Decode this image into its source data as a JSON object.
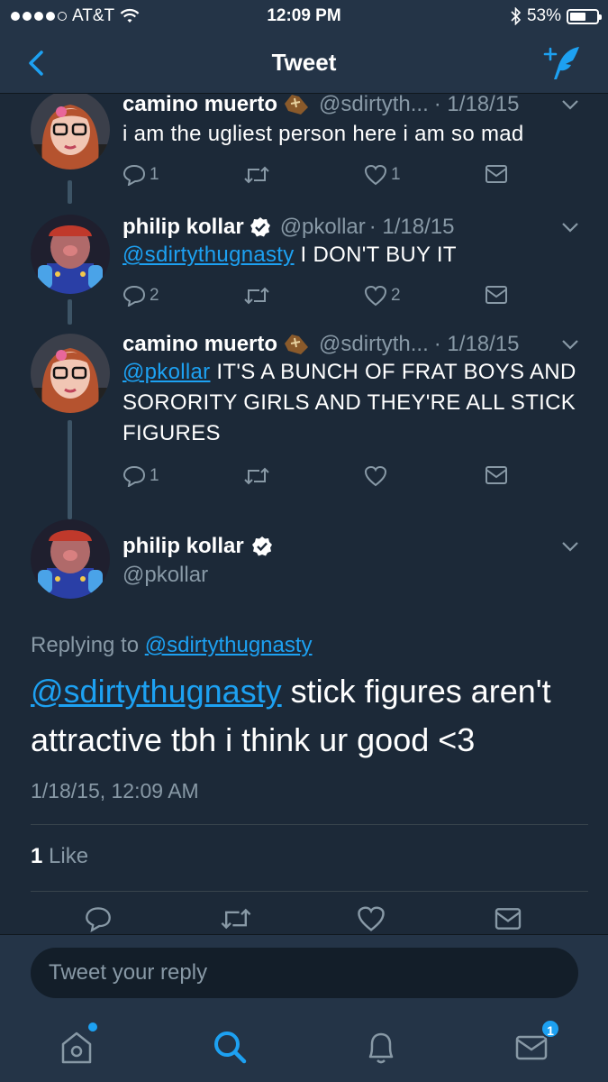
{
  "status_bar": {
    "carrier": "AT&T",
    "time": "12:09 PM",
    "battery": "53%"
  },
  "nav": {
    "title": "Tweet"
  },
  "thread": [
    {
      "name": "camino muerto",
      "handle": "@sdirtyth...",
      "date": "· 1/18/15",
      "text": "i am the ugliest person here i am so mad",
      "mention": "",
      "replies": "1",
      "likes": "1",
      "emoji": "coffin-icon"
    },
    {
      "name": "philip kollar",
      "handle": "@pkollar",
      "date": "· 1/18/15",
      "mention": "@sdirtythugnasty",
      "text": " I DON'T BUY IT",
      "replies": "2",
      "likes": "2",
      "verified": true
    },
    {
      "name": "camino muerto",
      "handle": "@sdirtyth...",
      "date": "· 1/18/15",
      "mention": "@pkollar",
      "text": " IT'S A BUNCH OF FRAT BOYS AND SORORITY GIRLS AND THEY'RE ALL STICK FIGURES",
      "replies": "1",
      "likes": "",
      "emoji": "coffin-icon"
    }
  ],
  "focused": {
    "name": "philip kollar",
    "handle": "@pkollar",
    "replying_label": "Replying to",
    "replying_to": "@sdirtythugnasty",
    "mention": "@sdirtythugnasty",
    "text": " stick figures aren't attractive tbh i think ur good <3",
    "timestamp": "1/18/15, 12:09 AM",
    "like_count": "1",
    "like_label": " Like"
  },
  "reply": {
    "placeholder": "Tweet your reply"
  },
  "tabs": {
    "messages_badge": "1"
  },
  "colors": {
    "background": "#1c2938",
    "bar": "#243447",
    "accent": "#1da1f2",
    "muted": "#8899a6"
  }
}
